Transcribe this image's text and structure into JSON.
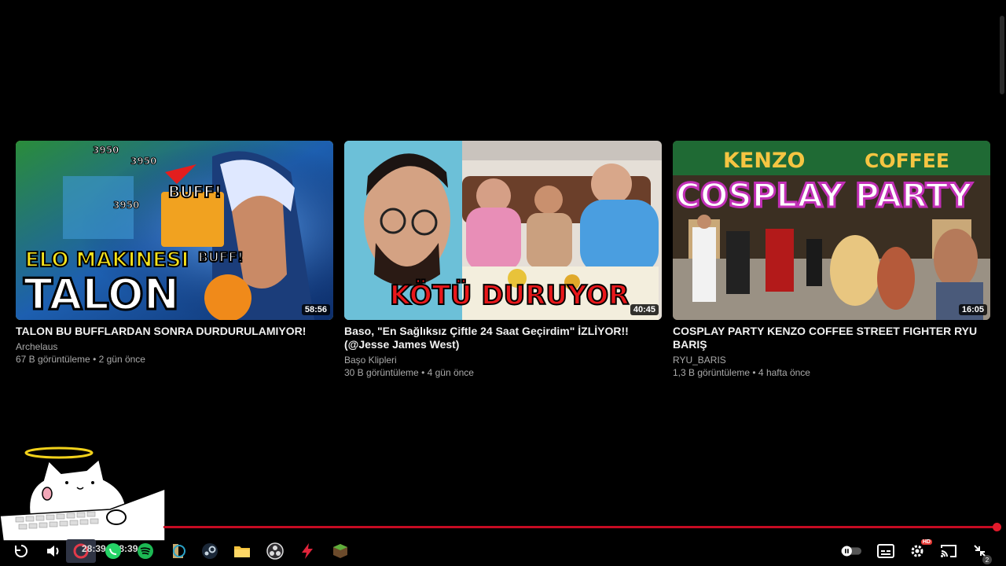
{
  "videos": [
    {
      "title": "TALON BU BUFFLARDAN SONRA DURDURULAMIYOR!",
      "channel": "Archelaus",
      "stats": "67 B görüntüleme • 2 gün önce",
      "duration": "58:56",
      "thumb_text": [
        "ELO MAKINESI",
        "TALON",
        "BUFF!",
        "BUFF!",
        "3950",
        "3950",
        "3950"
      ]
    },
    {
      "title": "Baso, \"En Sağlıksız Çiftle 24 Saat Geçirdim\" İZLİYOR!! (@Jesse James West)",
      "channel": "Başo Klipleri",
      "stats": "30 B görüntüleme • 4 gün önce",
      "duration": "40:45",
      "thumb_text": [
        "KÖTÜ DURUYOR"
      ]
    },
    {
      "title": "COSPLAY PARTY KENZO COFFEE STREET FIGHTER RYU BARIŞ",
      "channel": "RYU_BARIS",
      "stats": "1,3 B görüntüleme • 4 hafta önce",
      "duration": "16:05",
      "thumb_text": [
        "KENZO",
        "COFFEE",
        "COSPLAY PARTY"
      ]
    }
  ],
  "player": {
    "time_display": "28:39 / 28:39",
    "progress": 1.0,
    "settings_badge": "HD",
    "miniplayer_badge": "2"
  },
  "taskbar": [
    "opera-icon",
    "whatsapp-icon",
    "spotify-icon",
    "league-icon",
    "steam-icon",
    "folder-icon",
    "obs-icon",
    "flash-icon",
    "minecraft-icon"
  ],
  "colors": {
    "accent": "#c50b22",
    "selected_outline": "#e9ef3b"
  }
}
